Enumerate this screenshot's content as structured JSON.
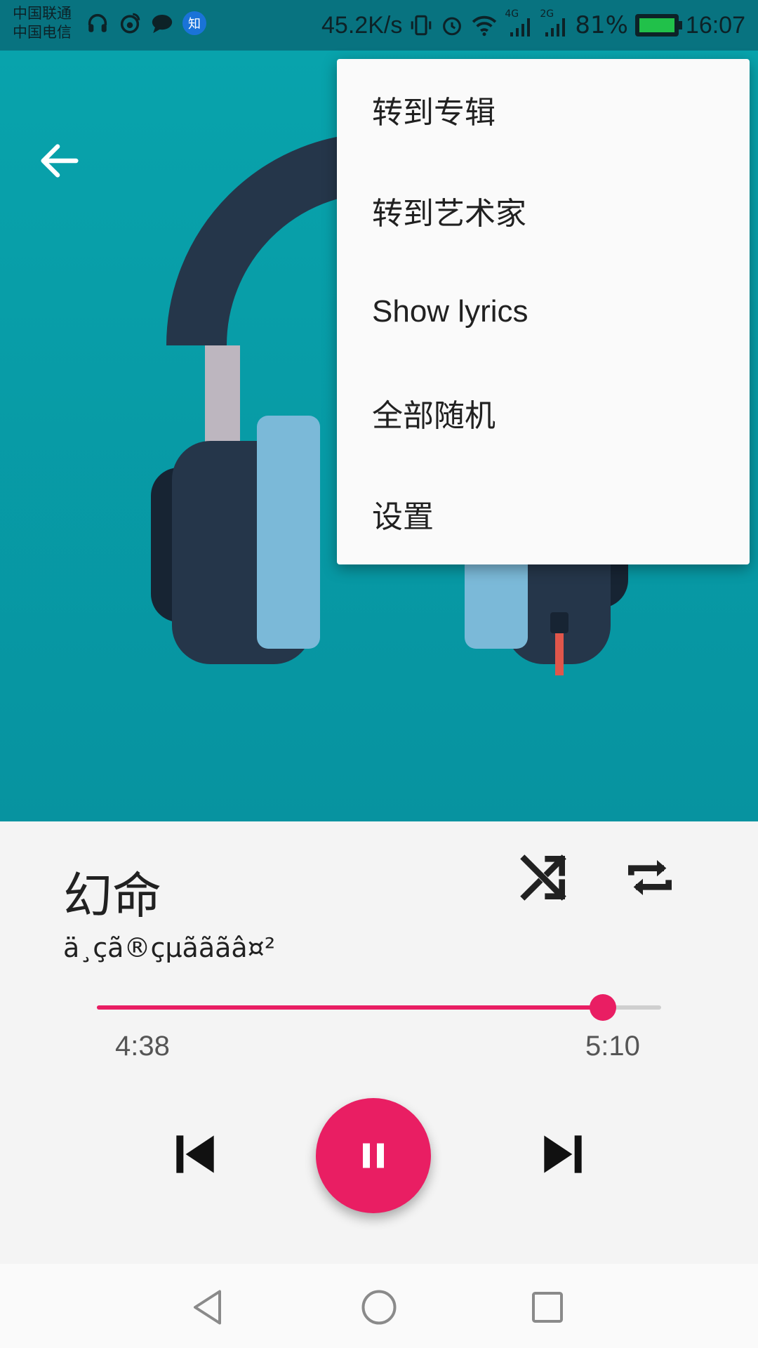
{
  "status_bar": {
    "carrier_1": "中国联通",
    "carrier_2": "中国电信",
    "left_icons": [
      "headphones-icon",
      "weibo-icon",
      "chat-icon",
      "zhihu-icon"
    ],
    "zhihu_badge": "知",
    "net_speed": "45.2K/s",
    "signal_1_label": "4G",
    "signal_2_label": "2G",
    "battery": "81%",
    "time": "16:07"
  },
  "colors": {
    "album_bg": "#07949f",
    "accent": "#e91e63",
    "menu_bg": "#fafafa"
  },
  "menu": {
    "items": [
      {
        "label": "转到专辑"
      },
      {
        "label": "转到艺术家"
      },
      {
        "label": "Show lyrics"
      },
      {
        "label": "全部随机"
      },
      {
        "label": "设置"
      }
    ]
  },
  "player": {
    "title": "幻命",
    "artist": "ä¸ç­ã®çµãããâ¤²",
    "elapsed": "4:38",
    "duration": "5:10",
    "progress": 0.897
  },
  "nav": {
    "icons": [
      "back-triangle-icon",
      "home-circle-icon",
      "recents-square-icon"
    ]
  }
}
